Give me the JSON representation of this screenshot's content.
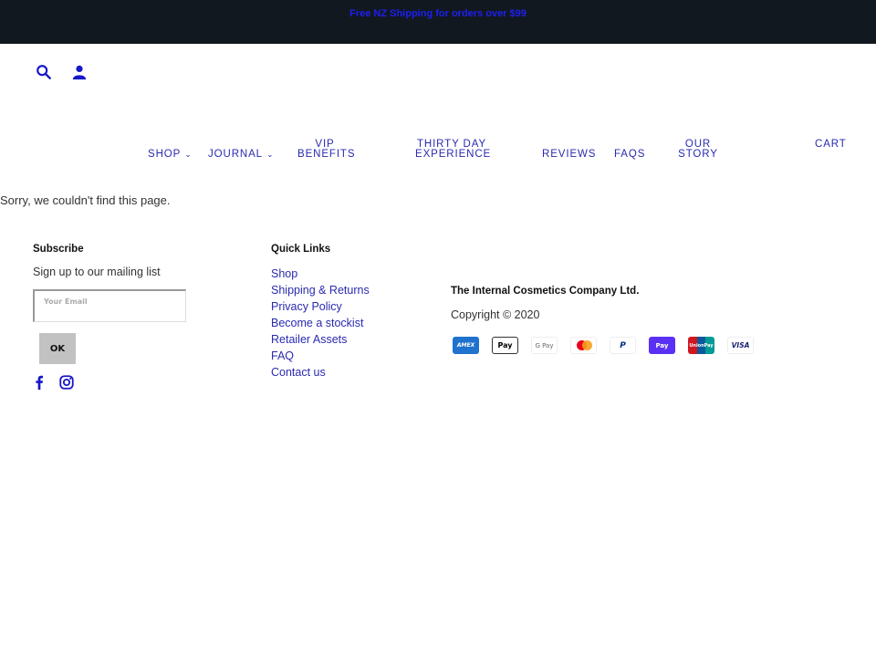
{
  "announcement": {
    "text": "Free NZ Shipping for orders over $99"
  },
  "header": {
    "icons": [
      {
        "name": "search-icon"
      },
      {
        "name": "account-icon"
      }
    ]
  },
  "nav": {
    "items": [
      {
        "label": "Shop",
        "has_dropdown": true
      },
      {
        "label": "Journal",
        "has_dropdown": true
      },
      {
        "label": "VIP Benefits",
        "has_dropdown": false
      },
      {
        "label": "Thirty Day Experience",
        "has_dropdown": false
      },
      {
        "label": "Reviews",
        "has_dropdown": false
      },
      {
        "label": "FAQs",
        "has_dropdown": false
      },
      {
        "label": "Our Story",
        "has_dropdown": false
      }
    ],
    "chevron": "⌄",
    "cart_label": "Cart"
  },
  "main": {
    "message": "Sorry, we couldn't find this page."
  },
  "footer": {
    "subscribe": {
      "title": "Subscribe",
      "text": "Sign up to our mailing list",
      "email_placeholder": "Your Email",
      "email_value": "",
      "button_label": "OK"
    },
    "social": [
      {
        "name": "facebook-icon"
      },
      {
        "name": "instagram-icon"
      }
    ],
    "quick_links": {
      "title": "Quick Links",
      "items": [
        "Shop",
        "Shipping & Returns",
        "Privacy Policy",
        "Become a stockist",
        "Retailer Assets",
        "FAQ",
        "Contact us"
      ]
    },
    "company": "The Internal Cosmetics Company Ltd.",
    "copyright": "Copyright © 2020",
    "payment_methods": [
      {
        "name": "American Express",
        "label": "AMEX"
      },
      {
        "name": "Apple Pay",
        "label": " Pay"
      },
      {
        "name": "Google Pay",
        "label": "G Pay"
      },
      {
        "name": "Mastercard",
        "label": ""
      },
      {
        "name": "PayPal",
        "label": "P"
      },
      {
        "name": "Shop Pay",
        "label": "Pay"
      },
      {
        "name": "Union Pay",
        "label": "UnionPay"
      },
      {
        "name": "Visa",
        "label": "VISA"
      }
    ]
  },
  "colors": {
    "announcement_bg": "#111820",
    "link": "#2a2ab0",
    "accent_blue": "#1f1ff0"
  }
}
